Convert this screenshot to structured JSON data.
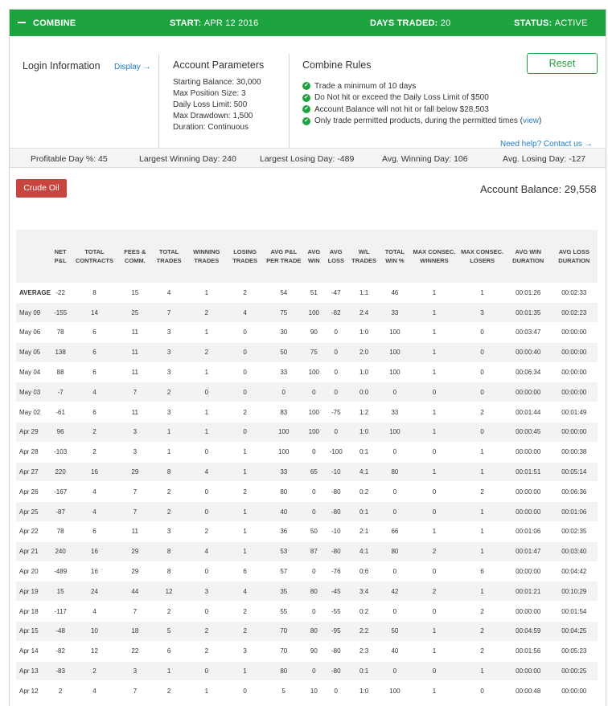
{
  "header": {
    "combine_label": "COMBINE",
    "start_label": "START:",
    "start_value": "APR 12 2016",
    "days_label": "DAYS TRADED:",
    "days_value": "20",
    "status_label": "STATUS:",
    "status_value": "ACTIVE",
    "bar_color": "#1ea43e"
  },
  "login": {
    "title": "Login Information",
    "display_link": "Display →"
  },
  "params": {
    "title": "Account Parameters",
    "items": [
      "Starting Balance: 30,000",
      "Max Position Size: 3",
      "Daily Loss Limit: 500",
      "Max Drawdown: 1,500",
      "Duration: Continuous"
    ]
  },
  "rules": {
    "title": "Combine Rules",
    "items": [
      "Trade a minimum of 10 days",
      "Do Not hit or exceed the Daily Loss Limit of $500",
      "Account Balance will not hit or fall below $28,503",
      "Only trade permitted products, during the permitted times ("
    ],
    "view_link": "view",
    "view_close": ")",
    "reset_label": "Reset",
    "help_link": "Need help? Contact us →"
  },
  "stats": {
    "profitable_day": "Profitable Day %: 45",
    "largest_winning": "Largest Winning Day: 240",
    "largest_losing": "Largest Losing Day: -489",
    "avg_winning": "Avg. Winning Day: 106",
    "avg_losing": "Avg. Losing Day: -127"
  },
  "product_button": "Crude Oil",
  "account_balance": "Account Balance: 29,558",
  "table": {
    "headers": [
      "",
      "NET P&L",
      "TOTAL CONTRACTS",
      "FEES & COMM.",
      "TOTAL TRADES",
      "WINNING TRADES",
      "LOSING TRADES",
      "AVG P&L PER TRADE",
      "AVG WIN",
      "AVG LOSS",
      "W/L TRADES",
      "TOTAL WIN %",
      "MAX CONSEC. WINNERS",
      "MAX CONSEC. LOSERS",
      "AVG WIN DURATION",
      "AVG LOSS DURATION"
    ],
    "rows": [
      [
        "AVERAGE",
        "-22",
        "8",
        "15",
        "4",
        "1",
        "2",
        "54",
        "51",
        "-47",
        "1:1",
        "46",
        "1",
        "1",
        "00:01:26",
        "00:02:33"
      ],
      [
        "May 09",
        "-155",
        "14",
        "25",
        "7",
        "2",
        "4",
        "75",
        "100",
        "-82",
        "2:4",
        "33",
        "1",
        "3",
        "00:01:35",
        "00:02:23"
      ],
      [
        "May 06",
        "78",
        "6",
        "11",
        "3",
        "1",
        "0",
        "30",
        "90",
        "0",
        "1:0",
        "100",
        "1",
        "0",
        "00:03:47",
        "00:00:00"
      ],
      [
        "May 05",
        "138",
        "6",
        "11",
        "3",
        "2",
        "0",
        "50",
        "75",
        "0",
        "2:0",
        "100",
        "1",
        "0",
        "00:00:40",
        "00:00:00"
      ],
      [
        "May 04",
        "88",
        "6",
        "11",
        "3",
        "1",
        "0",
        "33",
        "100",
        "0",
        "1:0",
        "100",
        "1",
        "0",
        "00:06:34",
        "00:00:00"
      ],
      [
        "May 03",
        "-7",
        "4",
        "7",
        "2",
        "0",
        "0",
        "0",
        "0",
        "0",
        "0:0",
        "0",
        "0",
        "0",
        "00:00:00",
        "00:00:00"
      ],
      [
        "May 02",
        "-61",
        "6",
        "11",
        "3",
        "1",
        "2",
        "83",
        "100",
        "-75",
        "1:2",
        "33",
        "1",
        "2",
        "00:01:44",
        "00:01:49"
      ],
      [
        "Apr 29",
        "96",
        "2",
        "3",
        "1",
        "1",
        "0",
        "100",
        "100",
        "0",
        "1:0",
        "100",
        "1",
        "0",
        "00:00:45",
        "00:00:00"
      ],
      [
        "Apr 28",
        "-103",
        "2",
        "3",
        "1",
        "0",
        "1",
        "100",
        "0",
        "-100",
        "0:1",
        "0",
        "0",
        "1",
        "00:00:00",
        "00:00:38"
      ],
      [
        "Apr 27",
        "220",
        "16",
        "29",
        "8",
        "4",
        "1",
        "33",
        "65",
        "-10",
        "4:1",
        "80",
        "1",
        "1",
        "00:01:51",
        "00:05:14"
      ],
      [
        "Apr 26",
        "-167",
        "4",
        "7",
        "2",
        "0",
        "2",
        "80",
        "0",
        "-80",
        "0:2",
        "0",
        "0",
        "2",
        "00:00:00",
        "00:06:36"
      ],
      [
        "Apr 25",
        "-87",
        "4",
        "7",
        "2",
        "0",
        "1",
        "40",
        "0",
        "-80",
        "0:1",
        "0",
        "0",
        "1",
        "00:00:00",
        "00:01:06"
      ],
      [
        "Apr 22",
        "78",
        "6",
        "11",
        "3",
        "2",
        "1",
        "36",
        "50",
        "-10",
        "2:1",
        "66",
        "1",
        "1",
        "00:01:06",
        "00:02:35"
      ],
      [
        "Apr 21",
        "240",
        "16",
        "29",
        "8",
        "4",
        "1",
        "53",
        "87",
        "-80",
        "4:1",
        "80",
        "2",
        "1",
        "00:01:47",
        "00:03:40"
      ],
      [
        "Apr 20",
        "-489",
        "16",
        "29",
        "8",
        "0",
        "6",
        "57",
        "0",
        "-76",
        "0:6",
        "0",
        "0",
        "6",
        "00:00:00",
        "00:04:42"
      ],
      [
        "Apr 19",
        "15",
        "24",
        "44",
        "12",
        "3",
        "4",
        "35",
        "80",
        "-45",
        "3:4",
        "42",
        "2",
        "1",
        "00:01:21",
        "00:10:29"
      ],
      [
        "Apr 18",
        "-117",
        "4",
        "7",
        "2",
        "0",
        "2",
        "55",
        "0",
        "-55",
        "0:2",
        "0",
        "0",
        "2",
        "00:00:00",
        "00:01:54"
      ],
      [
        "Apr 15",
        "-48",
        "10",
        "18",
        "5",
        "2",
        "2",
        "70",
        "80",
        "-95",
        "2:2",
        "50",
        "1",
        "2",
        "00:04:59",
        "00:04:25"
      ],
      [
        "Apr 14",
        "-82",
        "12",
        "22",
        "6",
        "2",
        "3",
        "70",
        "90",
        "-80",
        "2:3",
        "40",
        "1",
        "2",
        "00:01:56",
        "00:05:23"
      ],
      [
        "Apr 13",
        "-83",
        "2",
        "3",
        "1",
        "0",
        "1",
        "80",
        "0",
        "-80",
        "0:1",
        "0",
        "0",
        "1",
        "00:00:00",
        "00:00:25"
      ],
      [
        "Apr 12",
        "2",
        "4",
        "7",
        "2",
        "1",
        "0",
        "5",
        "10",
        "0",
        "1:0",
        "100",
        "1",
        "0",
        "00:00:48",
        "00:00:00"
      ]
    ]
  }
}
